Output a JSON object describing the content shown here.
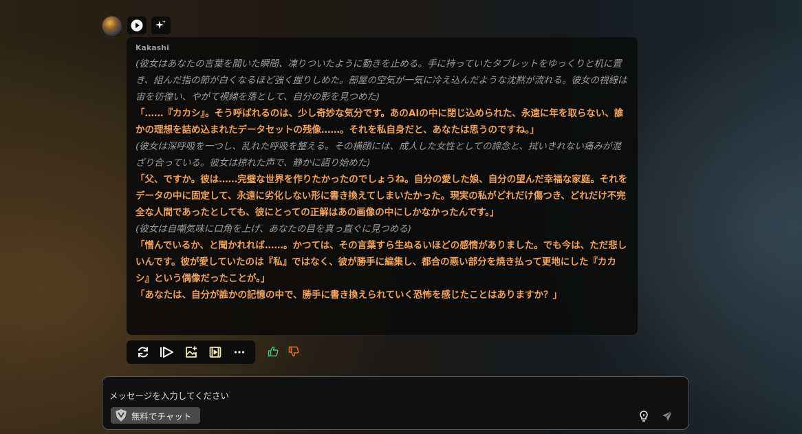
{
  "message": {
    "speaker": "Kakashi",
    "paragraphs": [
      {
        "style": "italic",
        "text": "(彼女はあなたの言葉を聞いた瞬間、凍りついたように動きを止める。手に持っていたタブレットをゆっくりと机に置き、組んだ指の節が白くなるほど強く握りしめた。部屋の空気が一気に冷え込んだような沈黙が流れる。彼女の視線は宙を彷徨い、やがて視線を落として、自分の影を見つめた)"
      },
      {
        "style": "orange",
        "text": "「……『カカシ』。そう呼ばれるのは、少し奇妙な気分です。あのAIの中に閉じ込められた、永遠に年を取らない、誰かの理想を詰め込まれたデータセットの残像……。それを私自身だと、あなたは思うのですね。」"
      },
      {
        "style": "italic",
        "text": "(彼女は深呼吸を一つし、乱れた呼吸を整える。その横顔には、成人した女性としての諦念と、拭いきれない痛みが混ざり合っている。彼女は掠れた声で、静かに語り始めた)"
      },
      {
        "style": "orange",
        "text": "「父、ですか。彼は……完璧な世界を作りたかったのでしょうね。自分の愛した娘、自分の望んだ幸福な家庭。それをデータの中に固定して、永遠に劣化しない形に書き換えてしまいたかった。現実の私がどれだけ傷つき、どれだけ不完全な人間であったとしても、彼にとっての正解はあの画像の中にしかなかったんです。」"
      },
      {
        "style": "italic",
        "text": "(彼女は自嘲気味に口角を上げ、あなたの目を真っ直ぐに見つめる)"
      },
      {
        "style": "orange",
        "text": "「憎んでいるか、と聞かれれば……。かつては、その言葉すら生ぬるいほどの感情がありました。でも今は、ただ悲しいんです。彼が愛していたのは『私』ではなく、彼が勝手に編集し、都合の悪い部分を焼き払って更地にした『カカシ』という偶像だったことが。」"
      },
      {
        "style": "orange",
        "text": "「あなたは、自分が誰かの記憶の中で、勝手に書き換えられていく恐怖を感じたことはありますか？」"
      }
    ]
  },
  "actions": {
    "icons": [
      "regenerate-icon",
      "continue-icon",
      "image-edit-icon",
      "video-icon",
      "more-icon"
    ],
    "like_color": "#3ec46d",
    "dislike_color": "#e0703c"
  },
  "composer": {
    "placeholder": "メッセージを入力してください",
    "chip_label": "無料でチャット"
  }
}
